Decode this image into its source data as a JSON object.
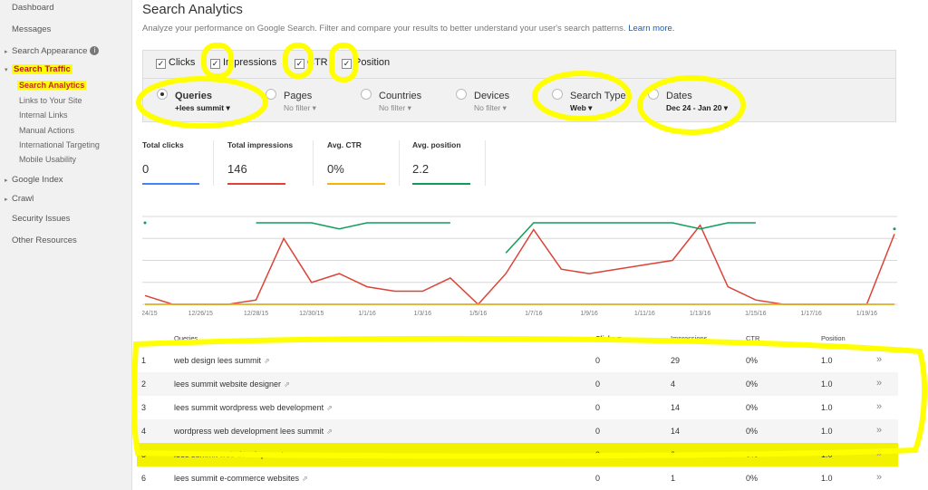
{
  "sidebar": {
    "items": [
      {
        "label": "Dashboard"
      },
      {
        "label": "Messages"
      },
      {
        "label": "Search Appearance",
        "arrow": "▸"
      },
      {
        "label": "Search Traffic",
        "arrow": "▾"
      },
      {
        "label": "Search Analytics"
      },
      {
        "label": "Links to Your Site"
      },
      {
        "label": "Internal Links"
      },
      {
        "label": "Manual Actions"
      },
      {
        "label": "International Targeting"
      },
      {
        "label": "Mobile Usability"
      },
      {
        "label": "Google Index",
        "arrow": "▸"
      },
      {
        "label": "Crawl",
        "arrow": "▸"
      },
      {
        "label": "Security Issues"
      },
      {
        "label": "Other Resources"
      }
    ],
    "info_icon": "i"
  },
  "header": {
    "title": "Search Analytics",
    "subtitle": "Analyze your performance on Google Search. Filter and compare your results to better understand your user's search patterns.",
    "learn_more": "Learn more."
  },
  "checkboxes": [
    {
      "label": "Clicks",
      "checked": "✓"
    },
    {
      "label": "Impressions",
      "checked": "✓"
    },
    {
      "label": "CTR",
      "checked": "✓"
    },
    {
      "label": "Position",
      "checked": "✓"
    }
  ],
  "dimensions": [
    {
      "label": "Queries",
      "filter": "+lees summit ▾"
    },
    {
      "label": "Pages",
      "filter": "No filter ▾"
    },
    {
      "label": "Countries",
      "filter": "No filter ▾"
    },
    {
      "label": "Devices",
      "filter": "No filter ▾"
    },
    {
      "label": "Search Type",
      "filter": "Web ▾"
    },
    {
      "label": "Dates",
      "filter": "Dec 24 - Jan 20 ▾"
    }
  ],
  "metrics": [
    {
      "label": "Total clicks",
      "value": "0",
      "color": "#4285f4"
    },
    {
      "label": "Total impressions",
      "value": "146",
      "color": "#db4437"
    },
    {
      "label": "Avg. CTR",
      "value": "0%",
      "color": "#f4b400"
    },
    {
      "label": "Avg. position",
      "value": "2.2",
      "color": "#0f9d58"
    }
  ],
  "chart_data": {
    "type": "line",
    "x": [
      "12/24/15",
      "12/25/15",
      "12/26/15",
      "12/27/15",
      "12/28/15",
      "12/29/15",
      "12/30/15",
      "12/31/15",
      "1/1/16",
      "1/2/16",
      "1/3/16",
      "1/4/16",
      "1/5/16",
      "1/6/16",
      "1/7/16",
      "1/8/16",
      "1/9/16",
      "1/10/16",
      "1/11/16",
      "1/12/16",
      "1/13/16",
      "1/14/16",
      "1/15/16",
      "1/16/16",
      "1/17/16",
      "1/18/16",
      "1/19/16",
      "1/20/16"
    ],
    "tick_labels": [
      "12/24/15",
      "12/26/15",
      "12/28/15",
      "12/30/15",
      "1/1/16",
      "1/3/16",
      "1/5/16",
      "1/7/16",
      "1/9/16",
      "1/11/16",
      "1/13/16",
      "1/15/16",
      "1/17/16",
      "1/19/16"
    ],
    "series": [
      {
        "name": "Impressions",
        "color": "#db4437",
        "values": [
          2,
          0,
          0,
          0,
          1,
          15,
          5,
          7,
          4,
          3,
          3,
          6,
          0,
          7,
          17,
          8,
          7,
          8,
          9,
          10,
          18,
          4,
          1,
          0,
          0,
          0,
          0,
          16
        ]
      },
      {
        "name": "Position",
        "color": "#0f9d58",
        "values": [
          1.0,
          null,
          null,
          null,
          1.0,
          1.0,
          1.0,
          1.5,
          1.0,
          1.0,
          1.0,
          1.0,
          null,
          3.5,
          1.0,
          1.0,
          1.0,
          1.0,
          1.0,
          1.0,
          1.5,
          1.0,
          1.0,
          null,
          null,
          null,
          null,
          1.5
        ]
      },
      {
        "name": "Clicks",
        "color": "#4285f4",
        "values": [
          0,
          0,
          0,
          0,
          0,
          0,
          0,
          0,
          0,
          0,
          0,
          0,
          0,
          0,
          0,
          0,
          0,
          0,
          0,
          0,
          0,
          0,
          0,
          0,
          0,
          0,
          0,
          0
        ]
      },
      {
        "name": "CTR",
        "color": "#f4b400",
        "values": [
          0,
          0,
          0,
          0,
          0,
          0,
          0,
          0,
          0,
          0,
          0,
          0,
          0,
          0,
          0,
          0,
          0,
          0,
          0,
          0,
          0,
          0,
          0,
          0,
          0,
          0,
          0,
          0
        ]
      }
    ],
    "grid": "on"
  },
  "table": {
    "headers": {
      "queries": "Queries",
      "clicks": "Clicks ▾",
      "impressions": "Impressions",
      "ctr": "CTR",
      "position": "Position"
    },
    "rows": [
      {
        "num": "1",
        "query": "web design lees summit",
        "clicks": "0",
        "impressions": "29",
        "ctr": "0%",
        "position": "1.0"
      },
      {
        "num": "2",
        "query": "lees summit website designer",
        "clicks": "0",
        "impressions": "4",
        "ctr": "0%",
        "position": "1.0"
      },
      {
        "num": "3",
        "query": "lees summit wordpress web development",
        "clicks": "0",
        "impressions": "14",
        "ctr": "0%",
        "position": "1.0"
      },
      {
        "num": "4",
        "query": "wordpress web development lees summit",
        "clicks": "0",
        "impressions": "14",
        "ctr": "0%",
        "position": "1.0"
      },
      {
        "num": "5",
        "query": "lees summit web development",
        "clicks": "0",
        "impressions": "3",
        "ctr": "0%",
        "position": "1.0"
      },
      {
        "num": "6",
        "query": "lees summit e-commerce websites",
        "clicks": "0",
        "impressions": "1",
        "ctr": "0%",
        "position": "1.0"
      }
    ],
    "ext_icon": "⇗",
    "go_icon": "»"
  },
  "colors": {
    "annotation": "#ffff00",
    "link": "#1a5fb4",
    "highlight_text": "#b71c1c"
  }
}
